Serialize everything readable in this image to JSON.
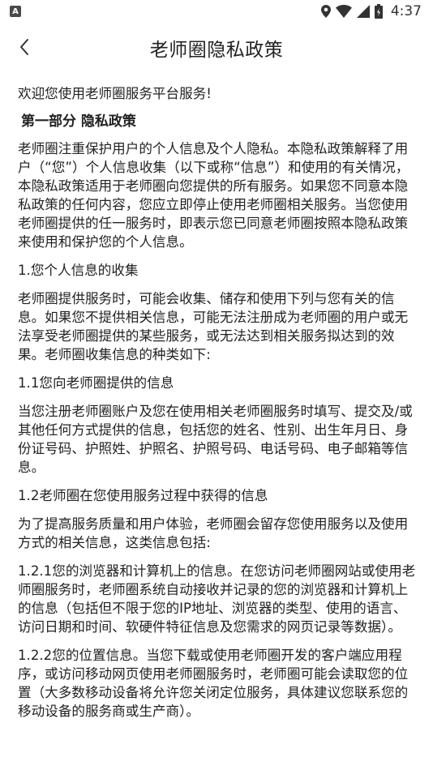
{
  "status_bar": {
    "left_badge": "A",
    "time": "4:37",
    "icons": [
      "location-icon",
      "wifi-icon",
      "signal-icon",
      "battery-icon"
    ]
  },
  "header": {
    "title": "老师圈隐私政策",
    "back_icon": "chevron-left-icon"
  },
  "content": {
    "welcome": "欢迎您使用老师圈服务平台服务!",
    "section1_title": "第一部分 隐私政策",
    "intro": "老师圈注重保护用户的个人信息及个人隐私。本隐私政策解释了用户（“您”）个人信息收集（以下或称“信息”）和使用的有关情况，本隐私政策适用于老师圈向您提供的所有服务。如果您不同意本隐私政策的任何内容，您应立即停止使用老师圈相关服务。当您使用老师圈提供的任一服务时，即表示您已同意老师圈按照本隐私政策来使用和保护您的个人信息。",
    "h1": "1.您个人信息的收集",
    "p1": "老师圈提供服务时，可能会收集、储存和使用下列与您有关的信息。如果您不提供相关信息，可能无法注册成为老师圈的用户或无法享受老师圈提供的某些服务，或无法达到相关服务拟达到的效果。老师圈收集信息的种类如下:",
    "h1_1": "1.1您向老师圈提供的信息",
    "p1_1": "当您注册老师圈账户及您在使用相关老师圈服务时填写、提交及/或其他任何方式提供的信息，包括您的姓名、性别、出生年月日、身份证号码、护照姓、护照名、护照号码、电话号码、电子邮箱等信息。",
    "h1_2": "1.2老师圈在您使用服务过程中获得的信息",
    "p1_2": "为了提高服务质量和用户体验，老师圈会留存您使用服务以及使用方式的相关信息，这类信息包括:",
    "p1_2_1": "1.2.1您的浏览器和计算机上的信息。在您访问老师圈网站或使用老师圈服务时，老师圈系统自动接收并记录的您的浏览器和计算机上的信息（包括但不限于您的IP地址、浏览器的类型、使用的语言、访问日期和时间、软硬件特征信息及您需求的网页记录等数据）。",
    "p1_2_2": "1.2.2您的位置信息。当您下载或使用老师圈开发的客户端应用程序，或访问移动网页使用老师圈服务时，老师圈可能会读取您的位置（大多数移动设备将允许您关闭定位服务，具体建议您联系您的移动设备的服务商或生产商）。"
  }
}
